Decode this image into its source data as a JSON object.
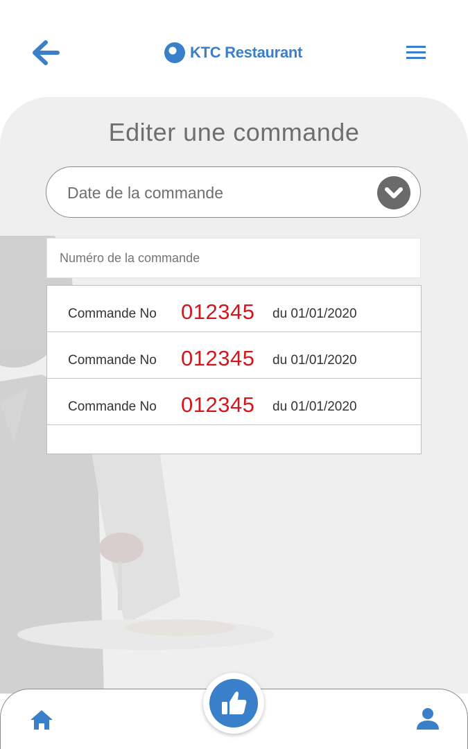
{
  "header": {
    "app_name": "KTC Restaurant",
    "back_icon": "arrow-left-icon",
    "menu_icon": "hamburger-menu-icon",
    "logo_icon": "ktc-logo-icon"
  },
  "page": {
    "title": "Editer une commande"
  },
  "date_select": {
    "label": "Date de la commande",
    "icon": "chevron-down-icon"
  },
  "order_number_input": {
    "placeholder": "Numéro de la commande",
    "value": ""
  },
  "orders": [
    {
      "label": "Commande No",
      "number": "012345",
      "date": "du 01/01/2020"
    },
    {
      "label": "Commande No",
      "number": "012345",
      "date": "du 01/01/2020"
    },
    {
      "label": "Commande No",
      "number": "012345",
      "date": "du 01/01/2020"
    }
  ],
  "bottom_nav": {
    "home_icon": "home-icon",
    "thumbs_icon": "thumbs-up-icon",
    "profile_icon": "user-profile-icon"
  },
  "colors": {
    "brand_blue": "#3a7fc9",
    "order_number_red": "#d4161c",
    "panel_gray": "#efefef",
    "title_gray": "#6e6e6e"
  }
}
